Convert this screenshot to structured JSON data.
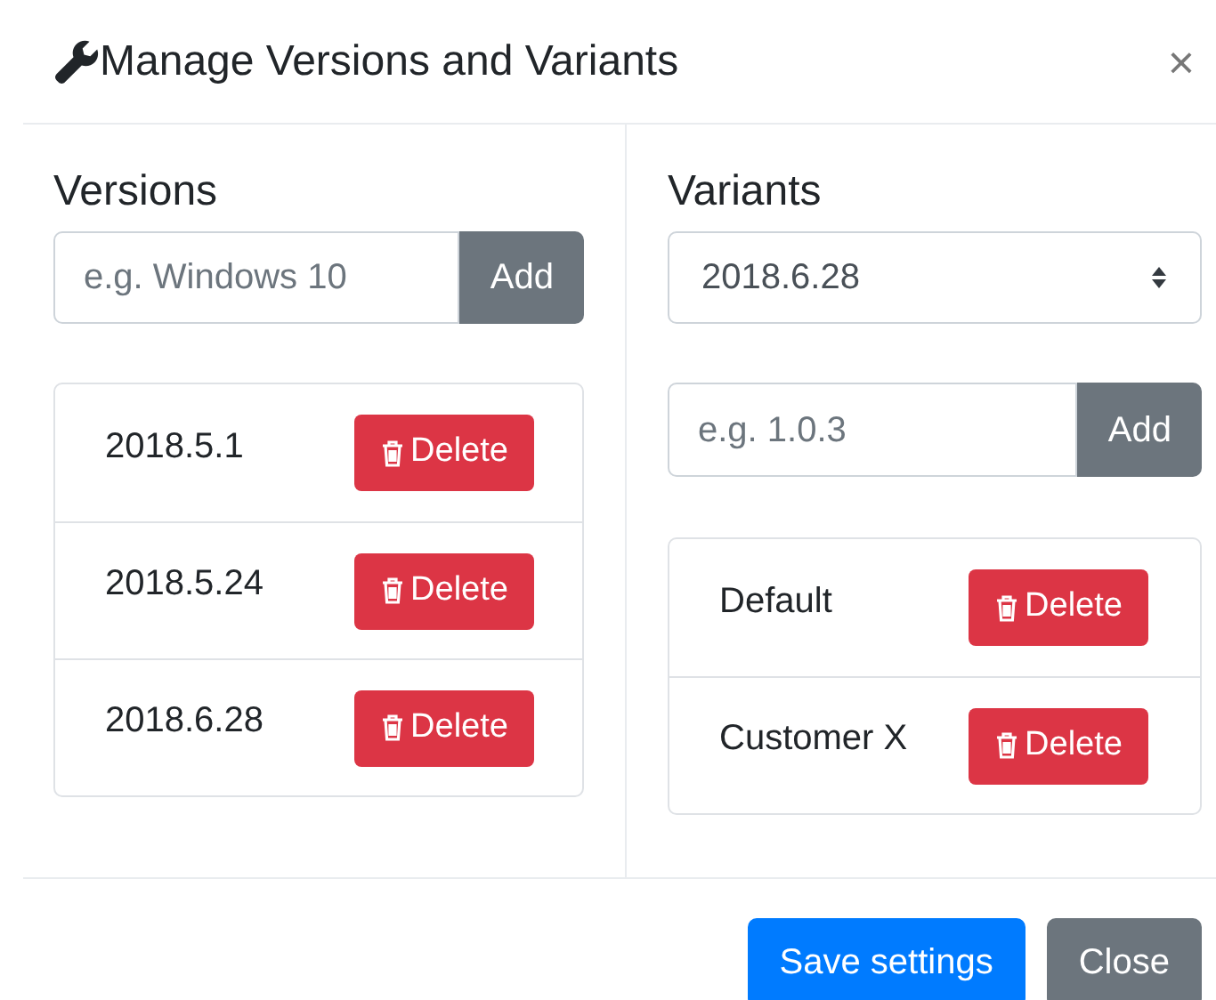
{
  "dialog": {
    "title": "Manage Versions and Variants",
    "close": "×"
  },
  "versions": {
    "heading": "Versions",
    "input": {
      "placeholder": "e.g. Windows 10"
    },
    "add_button": "Add",
    "items": [
      {
        "label": "2018.5.1",
        "delete": "Delete"
      },
      {
        "label": "2018.5.24",
        "delete": "Delete"
      },
      {
        "label": "2018.6.28",
        "delete": "Delete"
      }
    ]
  },
  "variants": {
    "heading": "Variants",
    "select": {
      "value": "2018.6.28"
    },
    "input": {
      "placeholder": "e.g. 1.0.3"
    },
    "add_button": "Add",
    "items": [
      {
        "label": "Default",
        "delete": "Delete"
      },
      {
        "label": "Customer X",
        "delete": "Delete"
      }
    ]
  },
  "footer": {
    "buttons": [
      {
        "label": "Save settings",
        "kind": "primary"
      },
      {
        "label": "Close",
        "kind": "secondary"
      }
    ]
  }
}
